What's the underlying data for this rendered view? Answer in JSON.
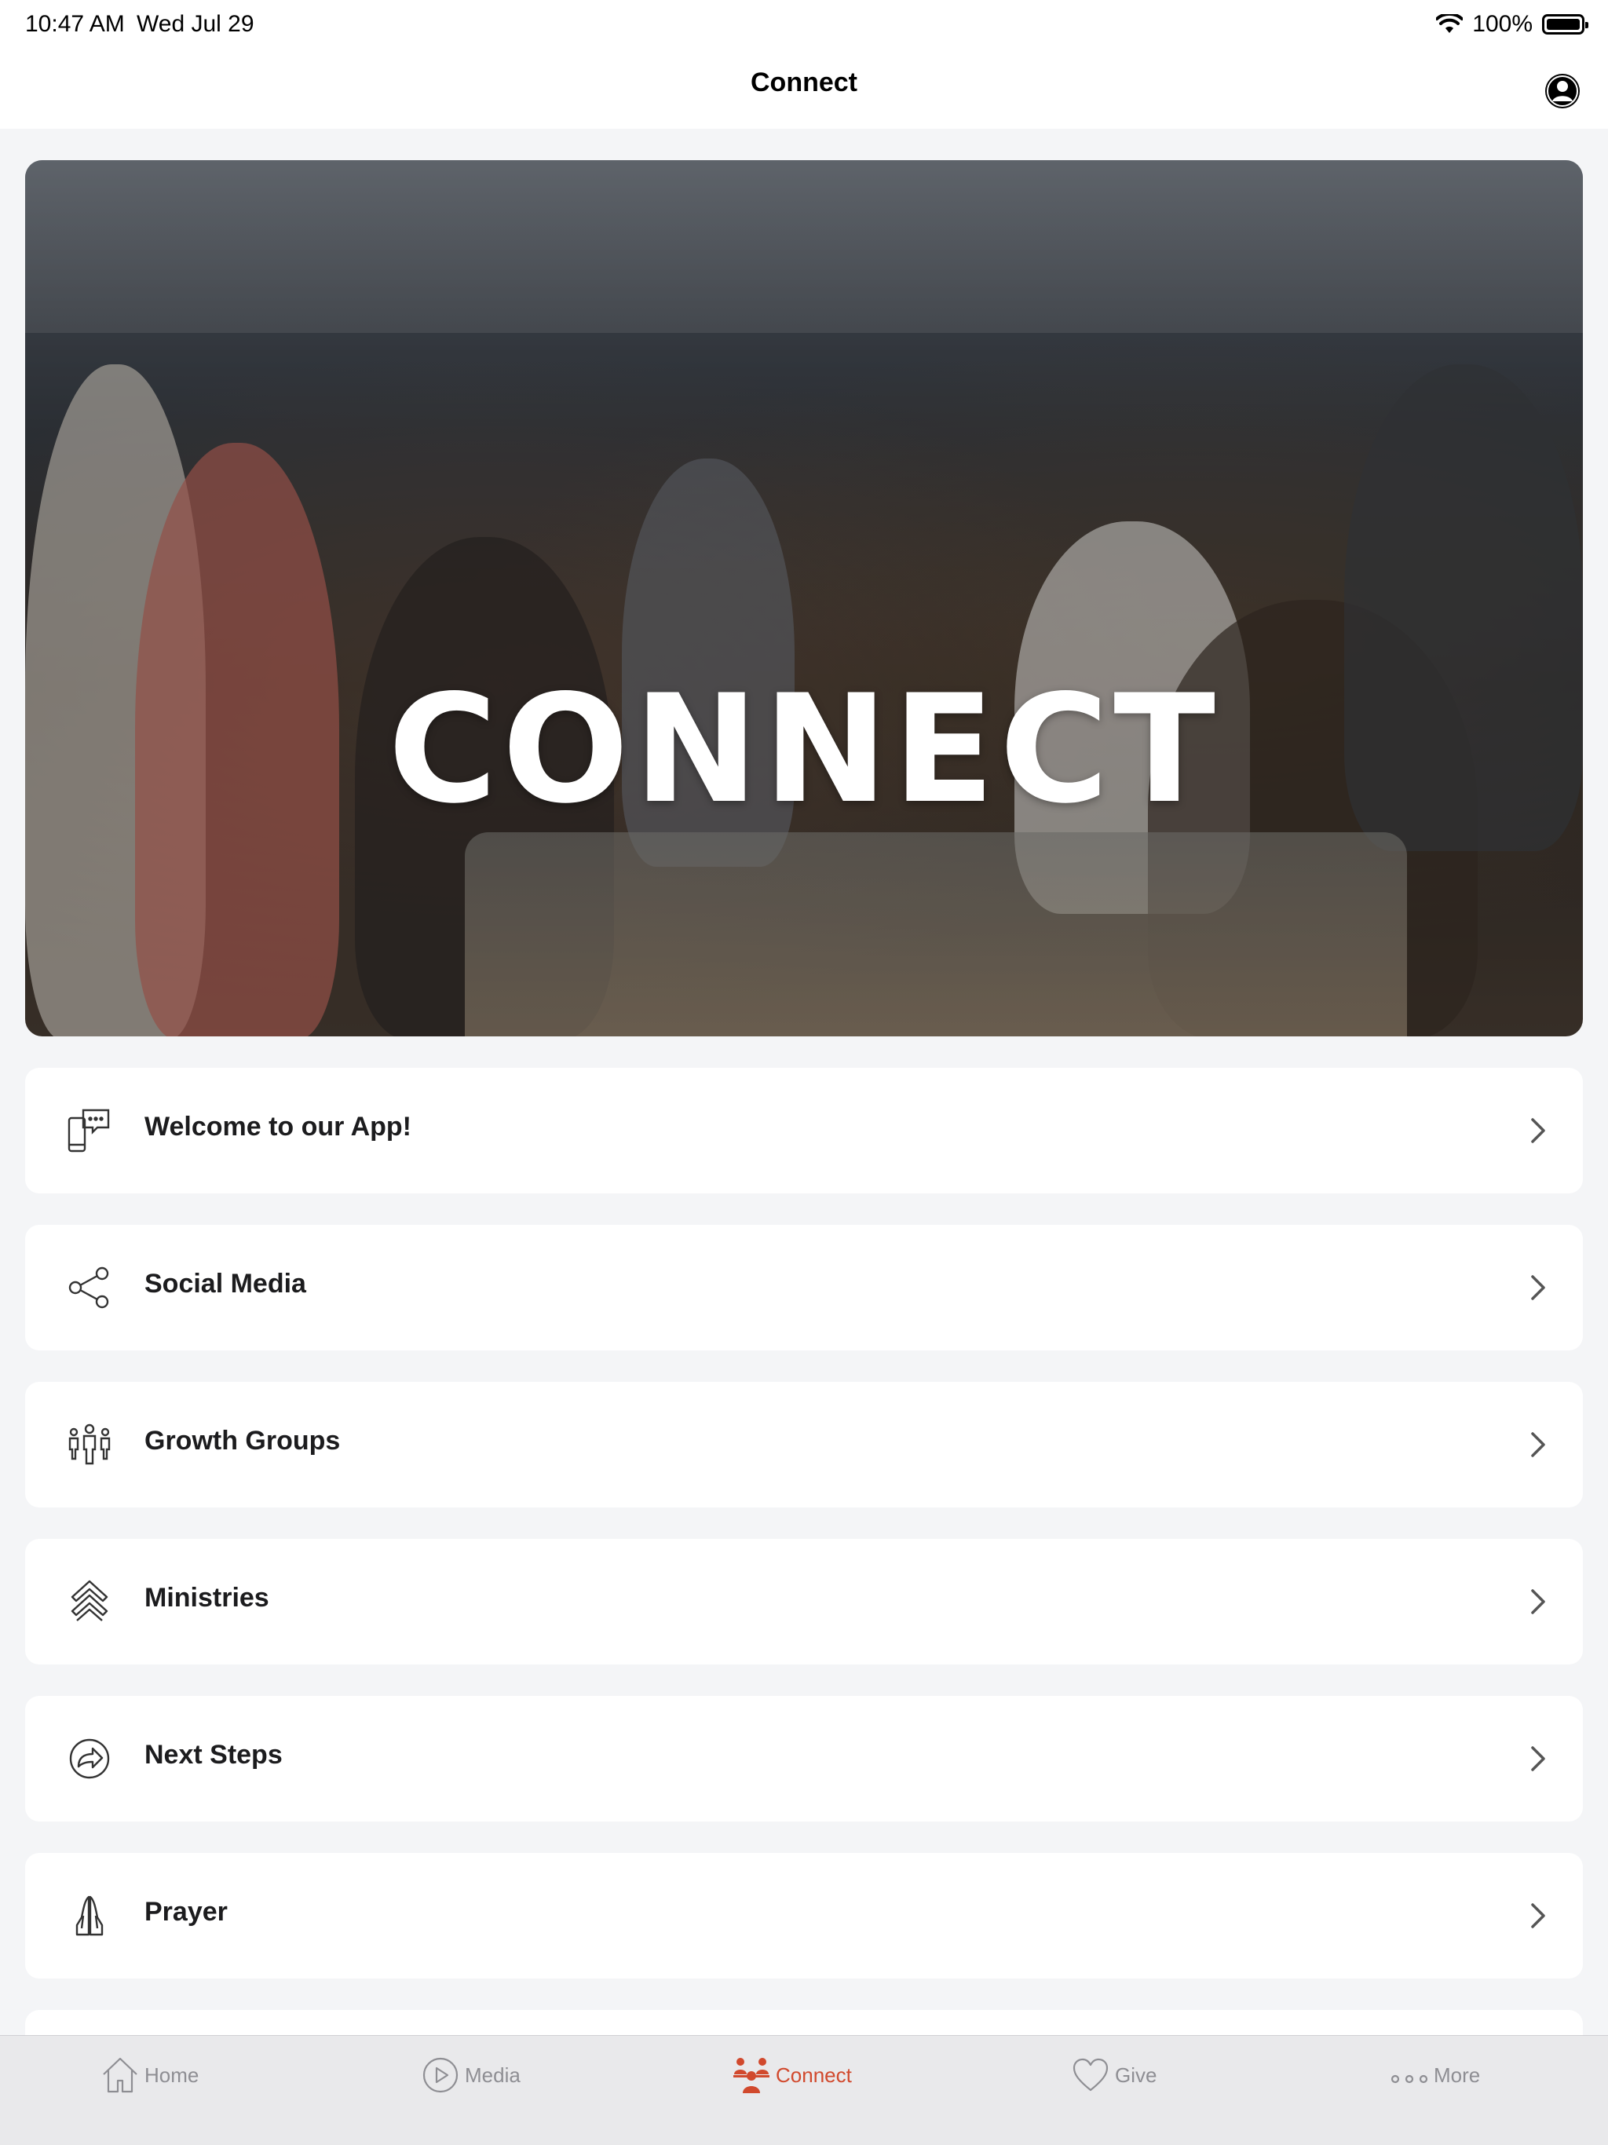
{
  "status_bar": {
    "time": "10:47 AM",
    "date": "Wed Jul 29",
    "battery": "100%"
  },
  "nav": {
    "title": "Connect"
  },
  "hero": {
    "title": "CONNECT"
  },
  "list_items": [
    {
      "label": "Welcome to our App!",
      "icon": "chat-phone-icon"
    },
    {
      "label": "Social Media",
      "icon": "share-icon"
    },
    {
      "label": "Growth Groups",
      "icon": "group-icon"
    },
    {
      "label": "Ministries",
      "icon": "chevrons-up-icon"
    },
    {
      "label": "Next Steps",
      "icon": "forward-arrow-icon"
    },
    {
      "label": "Prayer",
      "icon": "praying-hands-icon"
    }
  ],
  "tabs": [
    {
      "label": "Home",
      "icon": "home-icon"
    },
    {
      "label": "Media",
      "icon": "play-icon"
    },
    {
      "label": "Connect",
      "icon": "people-icon"
    },
    {
      "label": "Give",
      "icon": "heart-icon"
    },
    {
      "label": "More",
      "icon": "more-icon"
    }
  ],
  "colors": {
    "accent": "#d1492d",
    "background": "#f4f5f7",
    "tab_inactive": "#8e8e93"
  }
}
